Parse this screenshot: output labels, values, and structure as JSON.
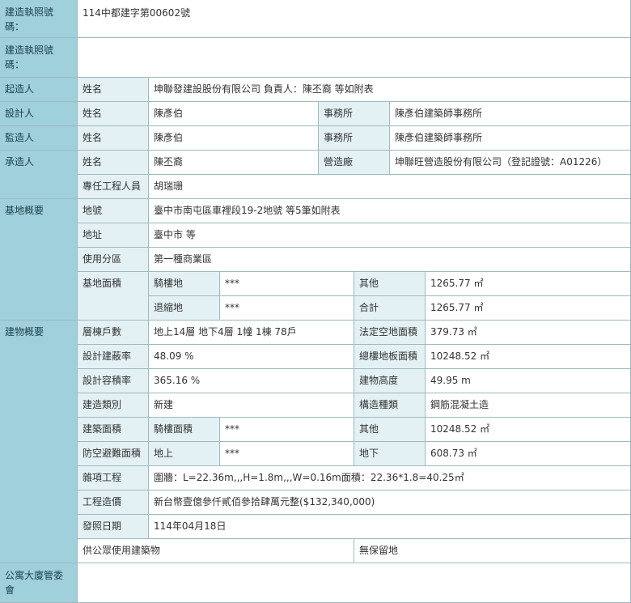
{
  "permit_number_label": "建造執照號碼：",
  "permit_number_value": "114中都建字第00602號",
  "permit_number_label_2": "建造執照號碼：",
  "permit_number_value_2": "",
  "initiator": {
    "section": "起造人",
    "name_label": "姓名",
    "name_value": "坤聯發建設股份有限公司 負責人：陳丕裔 等如附表"
  },
  "designer": {
    "section": "設計人",
    "name_label": "姓名",
    "name_value": "陳彥伯",
    "office_label": "事務所",
    "office_value": "陳彥伯建築師事務所"
  },
  "supervisor": {
    "section": "監造人",
    "name_label": "姓名",
    "name_value": "陳彥伯",
    "office_label": "事務所",
    "office_value": "陳彥伯建築師事務所"
  },
  "contractor": {
    "section": "承造人",
    "name_label": "姓名",
    "name_value": "陳丕裔",
    "firm_label": "營造廠",
    "firm_value": "坤聯旺營造股份有限公司（登記證號：A01226）",
    "engineer_label": "專任工程人員",
    "engineer_value": "胡瑞珊"
  },
  "site": {
    "section": "基地概要",
    "lot_label": "地號",
    "lot_value": "臺中市南屯區車裡段19-2地號 等5筆如附表",
    "address_label": "地址",
    "address_value": "臺中市 等",
    "zoning_label": "使用分區",
    "zoning_value": "第一種商業區",
    "area_label": "基地面積",
    "arcade_label": "騎樓地",
    "arcade_value": "***",
    "other_label": "其他",
    "other_value": "1265.77 ㎡",
    "setback_label": "退縮地",
    "setback_value": "***",
    "total_label": "合計",
    "total_value": "1265.77 ㎡"
  },
  "building": {
    "section": "建物概要",
    "floors_label": "層棟戶數",
    "floors_value": "地上14層 地下4層 1幢 1棟 78戶",
    "open_space_label": "法定空地面積",
    "open_space_value": "379.73 ㎡",
    "coverage_label": "設計建蔽率",
    "coverage_value": "48.09 %",
    "total_floor_label": "總樓地板面積",
    "total_floor_value": "10248.52 ㎡",
    "far_label": "設計容積率",
    "far_value": "365.16 %",
    "height_label": "建物高度",
    "height_value": "49.95 m",
    "type_label": "建造類別",
    "type_value": "新建",
    "structure_label": "構造種類",
    "structure_value": "鋼筋混凝土造",
    "area_label": "建築面積",
    "arcade_area_label": "騎樓面積",
    "arcade_area_value": "***",
    "area_other_label": "其他",
    "area_other_value": "10248.52 ㎡",
    "shelter_label": "防空避難面積",
    "above_label": "地上",
    "above_value": "***",
    "below_label": "地下",
    "below_value": "608.73 ㎡",
    "misc_label": "雜項工程",
    "misc_value": "圍牆：L=22.36m,,,H=1.8m,,,W=0.16m面積：22.36*1.8=40.25㎡",
    "cost_label": "工程造價",
    "cost_value": "新台幣壹億參仟貳佰參拾肆萬元整($132,340,000)",
    "issue_label": "發照日期",
    "issue_value": "114年04月18日",
    "public_label": "供公眾使用建築物",
    "nonreserve_label": "無保留地"
  },
  "management": {
    "section": "公寓大廈管委會"
  }
}
